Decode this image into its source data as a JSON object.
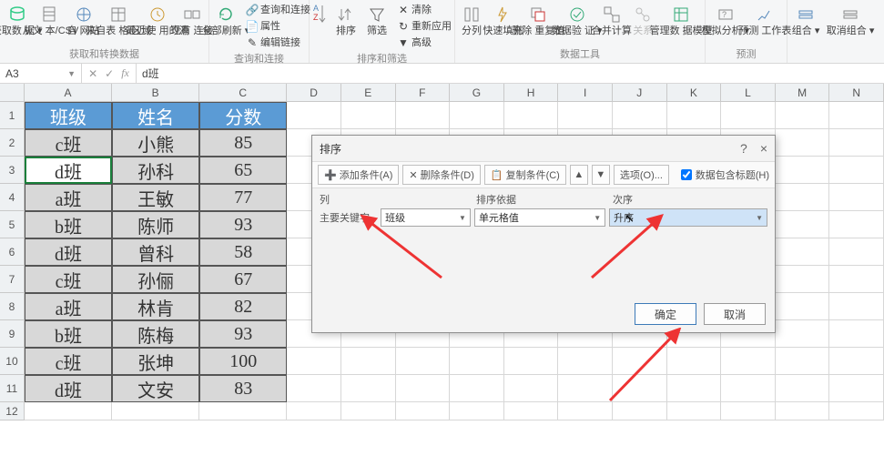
{
  "ribbon": {
    "groups": {
      "get_data": {
        "name": "获取和转换数据",
        "items": [
          "获取数\n据 ▾",
          "从文\n本/CSV",
          "自\n网站",
          "来自表\n格/区域",
          "最近使\n用的源",
          "现有\n连接"
        ]
      },
      "queries": {
        "name": "查询和连接",
        "refresh": "全部刷新\n▾",
        "side": [
          "查询和连接",
          "属性",
          "编辑链接"
        ]
      },
      "sort_filter": {
        "name": "排序和筛选",
        "sort_small": "",
        "sort": "排序",
        "filter": "筛选",
        "side": [
          "清除",
          "重新应用",
          "高级"
        ]
      },
      "data_tools": {
        "name": "数据工具",
        "items": [
          "分列",
          "快速填充",
          "删除\n重复值",
          "数据验\n证 ▾",
          "合并计算",
          "关系",
          "管理数\n据模型"
        ]
      },
      "forecast": {
        "name": "预测",
        "items": [
          "模拟分析\n▾",
          "预测\n工作表"
        ]
      },
      "outline": {
        "name": "",
        "items": [
          "组合\n▾",
          "取消组合\n▾"
        ]
      }
    }
  },
  "namebox": "A3",
  "formula": "d班",
  "columns": [
    "A",
    "B",
    "C",
    "D",
    "E",
    "F",
    "G",
    "H",
    "I",
    "J",
    "K",
    "L",
    "M",
    "N"
  ],
  "table": {
    "headers": [
      "班级",
      "姓名",
      "分数"
    ],
    "rows": [
      [
        "c班",
        "小熊",
        "85"
      ],
      [
        "d班",
        "孙科",
        "65"
      ],
      [
        "a班",
        "王敏",
        "77"
      ],
      [
        "b班",
        "陈师",
        "93"
      ],
      [
        "d班",
        "曾科",
        "58"
      ],
      [
        "c班",
        "孙俪",
        "67"
      ],
      [
        "a班",
        "林肯",
        "82"
      ],
      [
        "b班",
        "陈梅",
        "93"
      ],
      [
        "c班",
        "张坤",
        "100"
      ],
      [
        "d班",
        "文安",
        "83"
      ]
    ],
    "active_cell": {
      "row": 1,
      "col": 0
    }
  },
  "dialog": {
    "title": "排序",
    "help": "?",
    "close": "×",
    "toolbar": {
      "add": "添加条件(A)",
      "delete": "删除条件(D)",
      "copy": "复制条件(C)",
      "options": "选项(O)...",
      "checkbox": "数据包含标题(H)"
    },
    "headers": {
      "col": "列",
      "basis": "排序依据",
      "order": "次序"
    },
    "rule": {
      "label": "主要关键字",
      "col_value": "班级",
      "basis_value": "单元格值",
      "order_value": "升序"
    },
    "ok": "确定",
    "cancel": "取消"
  }
}
